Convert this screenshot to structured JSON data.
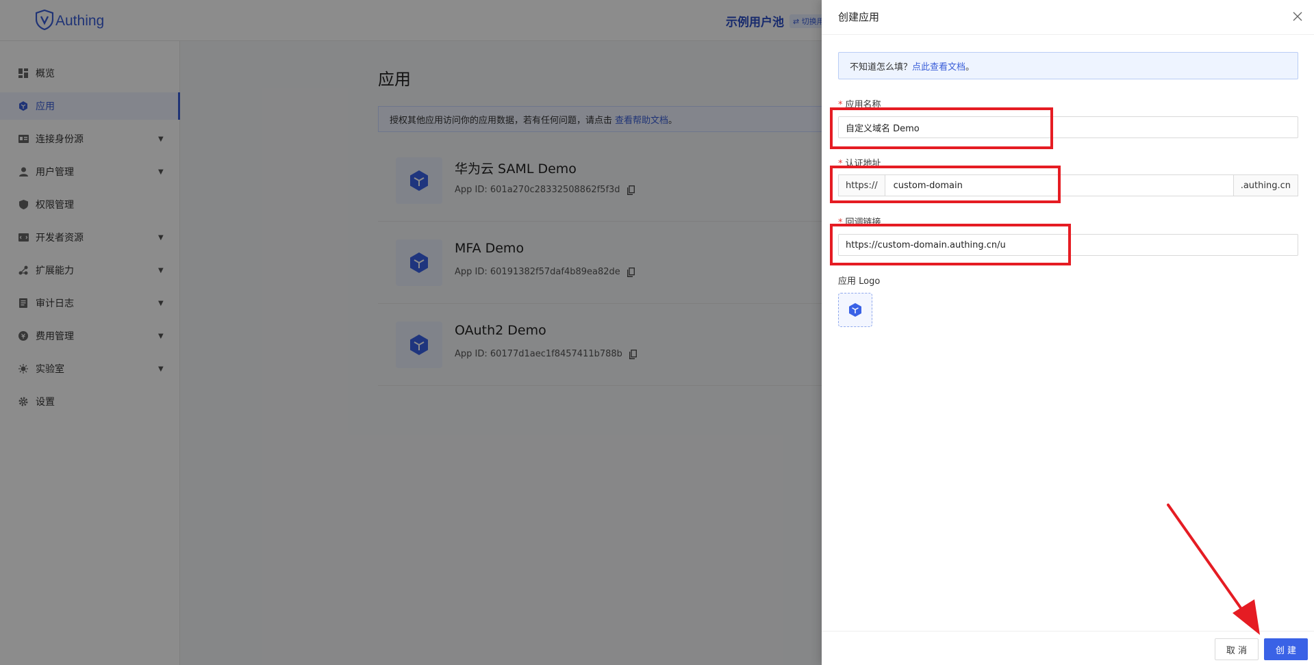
{
  "header": {
    "logo_text": "Authing",
    "pool_name": "示例用户池",
    "pool_switch": "⇄ 切换用"
  },
  "sidebar": {
    "items": [
      {
        "label": "概览",
        "icon": "dashboard-icon",
        "expandable": false,
        "active": false
      },
      {
        "label": "应用",
        "icon": "cube-icon",
        "expandable": false,
        "active": true
      },
      {
        "label": "连接身份源",
        "icon": "id-card-icon",
        "expandable": true,
        "active": false
      },
      {
        "label": "用户管理",
        "icon": "user-icon",
        "expandable": true,
        "active": false
      },
      {
        "label": "权限管理",
        "icon": "shield-icon",
        "expandable": false,
        "active": false
      },
      {
        "label": "开发者资源",
        "icon": "code-icon",
        "expandable": true,
        "active": false
      },
      {
        "label": "扩展能力",
        "icon": "extension-icon",
        "expandable": true,
        "active": false
      },
      {
        "label": "审计日志",
        "icon": "log-icon",
        "expandable": true,
        "active": false
      },
      {
        "label": "费用管理",
        "icon": "billing-icon",
        "expandable": true,
        "active": false
      },
      {
        "label": "实验室",
        "icon": "lab-icon",
        "expandable": true,
        "active": false
      },
      {
        "label": "设置",
        "icon": "gear-icon",
        "expandable": false,
        "active": false
      }
    ]
  },
  "main": {
    "title": "应用",
    "info_text": "授权其他应用访问你的应用数据，若有任何问题，请点击",
    "info_link": "查看帮助文档",
    "info_suffix": "。",
    "apps": [
      {
        "name": "华为云 SAML Demo",
        "app_id": "App ID: 601a270c28332508862f5f3d"
      },
      {
        "name": "MFA Demo",
        "app_id": "App ID: 60191382f57daf4b89ea82de"
      },
      {
        "name": "OAuth2 Demo",
        "app_id": "App ID: 60177d1aec1f8457411b788b"
      }
    ]
  },
  "drawer": {
    "title": "创建应用",
    "tip_text": "不知道怎么填？",
    "tip_link": "点此查看文档",
    "tip_suffix": "。",
    "fields": {
      "name_label": "应用名称",
      "name_value": "自定义域名 Demo",
      "auth_label": "认证地址",
      "auth_prefix": "https://",
      "auth_value": "custom-domain",
      "auth_suffix": ".authing.cn",
      "callback_label": "回调链接",
      "callback_value": "https://custom-domain.authing.cn/u",
      "logo_label": "应用 Logo"
    },
    "footer": {
      "cancel_label": "取 消",
      "create_label": "创 建"
    }
  },
  "colors": {
    "brand": "#3a5ed8",
    "primary_button": "#3a62e6",
    "highlight": "#e51c23"
  }
}
